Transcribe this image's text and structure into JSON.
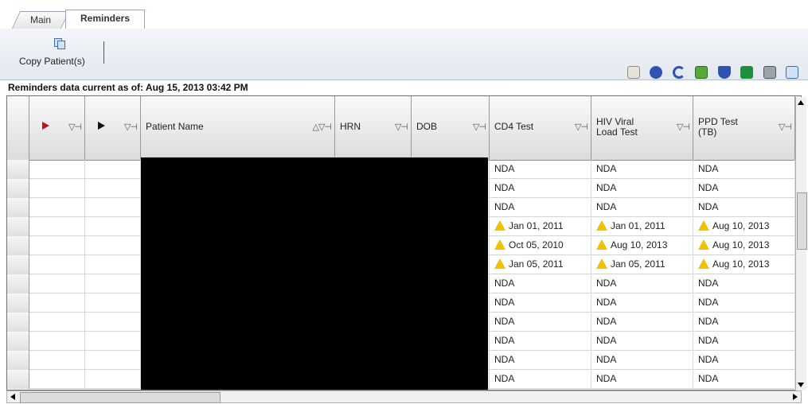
{
  "tabs": [
    {
      "label": "Main"
    },
    {
      "label": "Reminders"
    }
  ],
  "toolbar": {
    "copy_label": "Copy Patient(s)",
    "icons": [
      "mail-icon",
      "help-icon",
      "undo-icon",
      "refresh-icon",
      "find-icon",
      "excel-icon",
      "print-icon",
      "copy-icon"
    ]
  },
  "status": "Reminders data current as of:  Aug 15, 2013 03:42 PM",
  "grid": {
    "columns": {
      "patient_name": "Patient Name",
      "hrn": "HRN",
      "dob": "DOB",
      "cd4": "CD4 Test",
      "hiv_1": "HIV Viral",
      "hiv_2": "Load Test",
      "ppd_1": "PPD Test",
      "ppd_2": "(TB)"
    },
    "rows": [
      {
        "cd4": "NDA",
        "hiv": "NDA",
        "ppd": "NDA"
      },
      {
        "cd4": "NDA",
        "hiv": "NDA",
        "ppd": "NDA"
      },
      {
        "cd4": "NDA",
        "hiv": "NDA",
        "ppd": "NDA"
      },
      {
        "cd4": "Jan 01, 2011",
        "hiv": "Jan 01, 2011",
        "ppd": "Aug 10, 2013"
      },
      {
        "cd4": "Oct 05, 2010",
        "hiv": "Aug 10, 2013",
        "ppd": "Aug 10, 2013"
      },
      {
        "cd4": "Jan 05, 2011",
        "hiv": "Jan 05, 2011",
        "ppd": "Aug 10, 2013"
      },
      {
        "cd4": "NDA",
        "hiv": "NDA",
        "ppd": "NDA"
      },
      {
        "cd4": "NDA",
        "hiv": "NDA",
        "ppd": "NDA"
      },
      {
        "cd4": "NDA",
        "hiv": "NDA",
        "ppd": "NDA"
      },
      {
        "cd4": "NDA",
        "hiv": "NDA",
        "ppd": "NDA"
      },
      {
        "cd4": "NDA",
        "hiv": "NDA",
        "ppd": "NDA"
      },
      {
        "cd4": "NDA",
        "hiv": "NDA",
        "ppd": "NDA"
      }
    ]
  }
}
